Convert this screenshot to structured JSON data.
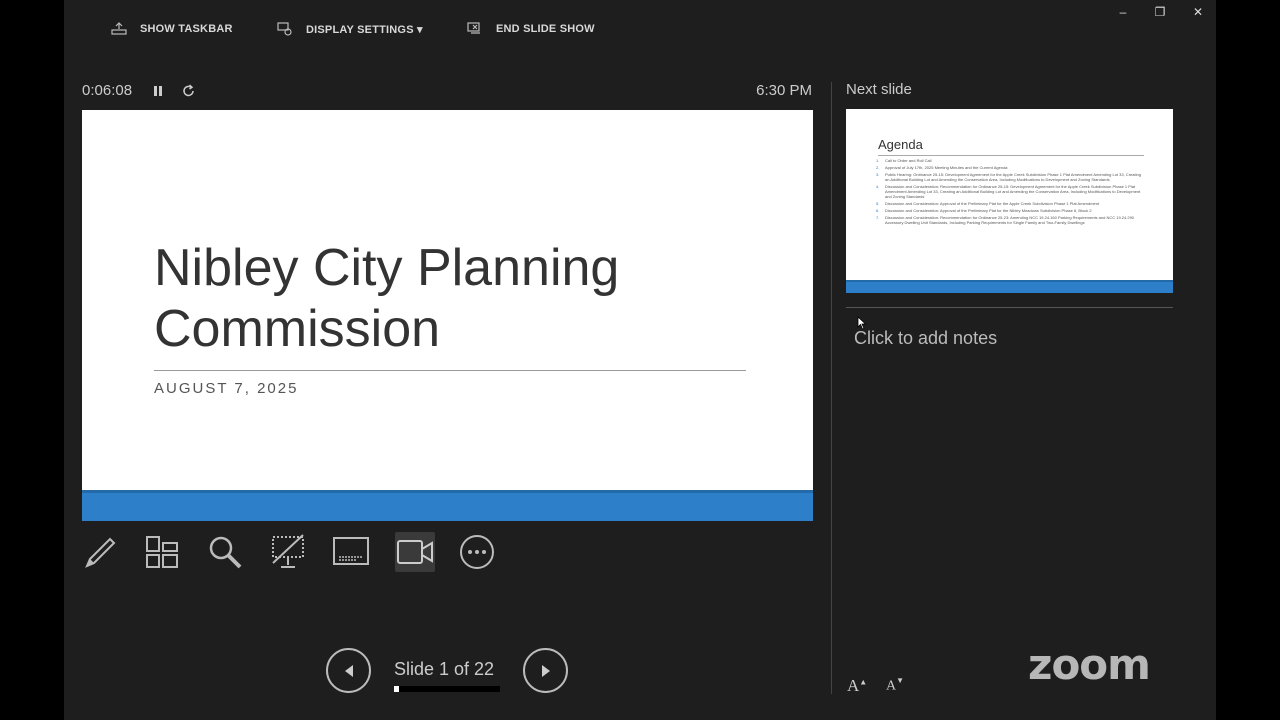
{
  "toolbar": {
    "show_taskbar": "SHOW TASKBAR",
    "display_settings": "DISPLAY SETTINGS ▾",
    "end_slide_show": "END SLIDE SHOW"
  },
  "window_controls": {
    "minimize": "–",
    "restore": "❐",
    "close": "✕"
  },
  "timer": {
    "elapsed": "0:06:08",
    "clock": "6:30 PM"
  },
  "current_slide": {
    "title": "Nibley City Planning Commission",
    "subtitle": "AUGUST 7, 2025",
    "band_color": "#2d7fc9"
  },
  "tools": [
    "pen-icon",
    "see-all-slides-icon",
    "zoom-icon",
    "black-screen-icon",
    "subtitles-icon",
    "camera-icon",
    "more-options-icon"
  ],
  "navigation": {
    "counter": "Slide 1 of 22",
    "current": 1,
    "total": 22
  },
  "next_slide": {
    "label": "Next slide",
    "title": "Agenda",
    "items": [
      "Call to Order and Roll Call",
      "Approval of July 17th, 2025 Meeting Minutes and the Current Agenda",
      "Public Hearing: Ordinance 25-15: Development Agreement for the Apple Creek Subdivision Phase 1 Plat Amendment Amending Lot 33, Creating an Additional Building Lot and Amending the Conservation Area, Including Modifications to Development and Zoning Standards",
      "Discussion and Consideration: Recommendation for Ordinance 25-15: Development Agreement for the Apple Creek Subdivision Phase 1 Plat Amendment Amending Lot 33, Creating an Additional Building Lot and Amending the Conservation Area, Including Modifications to Development and Zoning Standards",
      "Discussion and Consideration: Approval of the Preliminary Plat for the Apple Creek Subdivision Phase 1 Plat Amendment",
      "Discussion and Consideration: Approval of the Preliminary Plat for the Nibley Meadows Subdivision Phase 6, Block 2",
      "Discussion and Consideration: Recommendation for Ordinance 25-23: Amending NCC 19.24.160 Parking Requirements and NCC 19.24.290 Accessory Dwelling Unit Standards, Including Parking Requirements for Single Family and Two-Family Dwellings"
    ]
  },
  "notes": {
    "placeholder": "Click to add notes"
  },
  "font_controls": {
    "increase": "A",
    "decrease": "A"
  },
  "brand": {
    "logo_text": "zoom"
  }
}
